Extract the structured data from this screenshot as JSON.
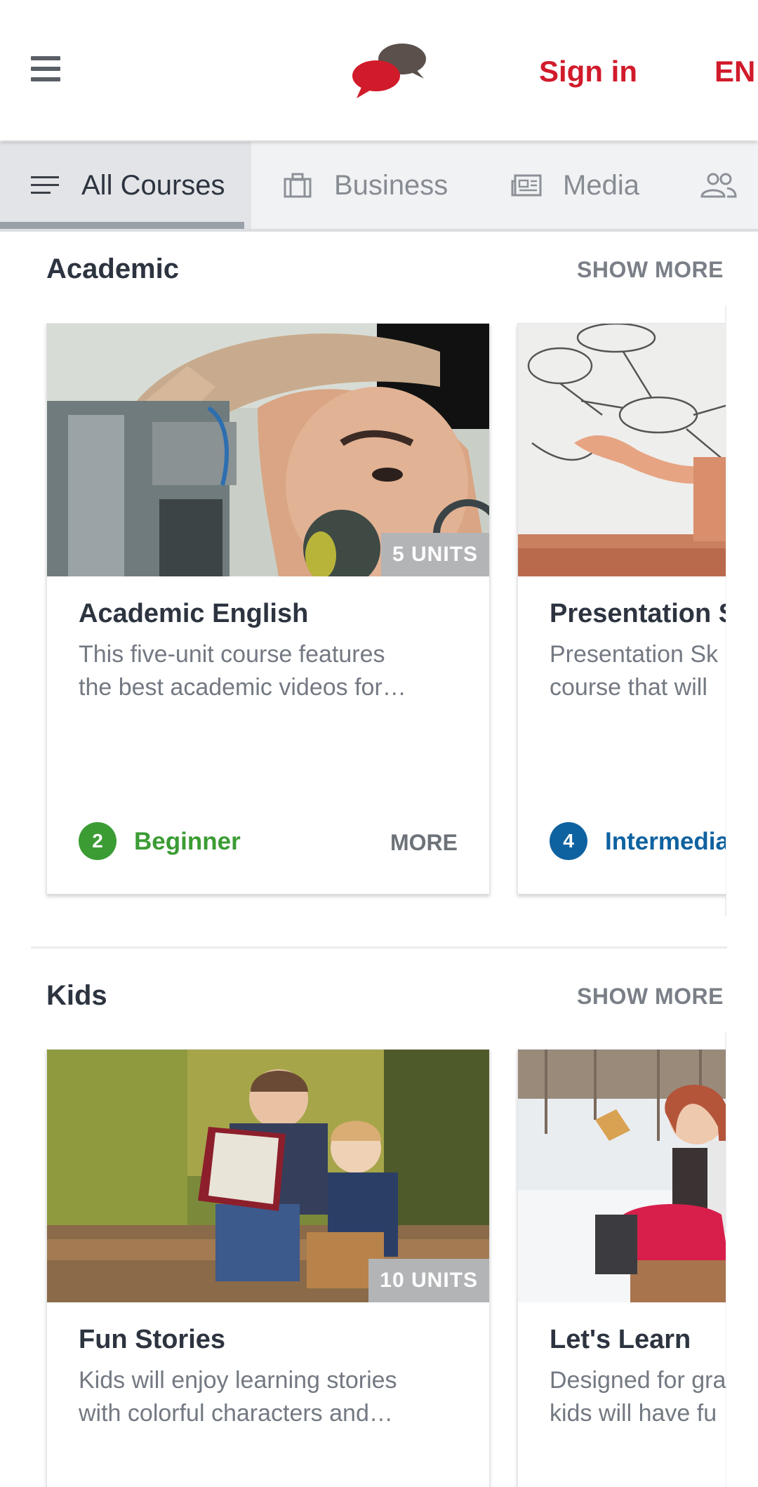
{
  "header": {
    "menu_icon": "hamburger-menu-icon",
    "logo_icon": "speech-bubbles-logo-icon",
    "sign_in": "Sign in",
    "language": "EN",
    "brand_color": "#d11b2b"
  },
  "tabs": [
    {
      "label": "All Courses",
      "icon": "list-icon",
      "active": true
    },
    {
      "label": "Business",
      "icon": "briefcase-icon",
      "active": false
    },
    {
      "label": "Media",
      "icon": "newspaper-icon",
      "active": false
    },
    {
      "label": "",
      "icon": "people-icon",
      "active": false
    }
  ],
  "sections": [
    {
      "title": "Academic",
      "show_more": "SHOW MORE",
      "cards": [
        {
          "title": "Academic English",
          "desc_line1": "This five-unit course features",
          "desc_line2": "the best academic videos for…",
          "units": "5 UNITS",
          "level_num": "2",
          "level_label": "Beginner",
          "level_color": "#3b9c34",
          "more": "MORE"
        },
        {
          "title": "Presentation S",
          "desc_line1": "Presentation Sk",
          "desc_line2": "course that will",
          "units": "",
          "level_num": "4",
          "level_label": "Intermedia",
          "level_color": "#0f62a0",
          "more": ""
        }
      ]
    },
    {
      "title": "Kids",
      "show_more": "SHOW MORE",
      "cards": [
        {
          "title": "Fun Stories",
          "desc_line1": "Kids will enjoy learning stories",
          "desc_line2": "with colorful characters and…",
          "units": "10 UNITS"
        },
        {
          "title": "Let's Learn",
          "desc_line1": "Designed for gra",
          "desc_line2": "kids will have fu",
          "units": ""
        }
      ]
    }
  ]
}
